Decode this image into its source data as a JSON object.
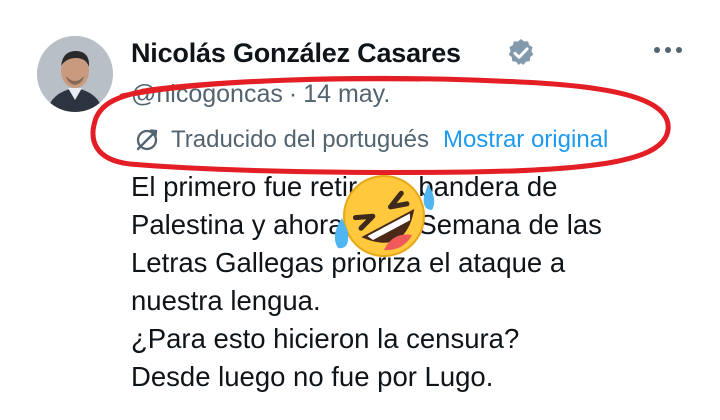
{
  "tweet": {
    "author": {
      "name": "Nicolás González Casares",
      "handle": "@nicogoncas",
      "timestamp": "14 may."
    },
    "separator": "·",
    "translation": {
      "label": "Traducido del portugués",
      "show_original": "Mostrar original"
    },
    "text_lines": [
      "El primero fue retirar la bandera de",
      "Palestina y ahora en la Semana de las",
      "Letras Gallegas prioriza el ataque a",
      "nuestra lengua.",
      "¿Para esto hicieron la censura?",
      "Desde luego no fue por Lugo."
    ]
  },
  "icons": {
    "verified": "verified-badge-icon",
    "more": "more-options-icon",
    "translate": "translate-icon",
    "emoji": "rolling-on-floor-laughing-emoji"
  },
  "colors": {
    "text": "#0f1419",
    "secondary": "#536471",
    "link": "#1d9bf0",
    "verified_badge": "#829aab",
    "annotation_red": "#e31e24",
    "emoji_yellow": "#ffc83d"
  }
}
